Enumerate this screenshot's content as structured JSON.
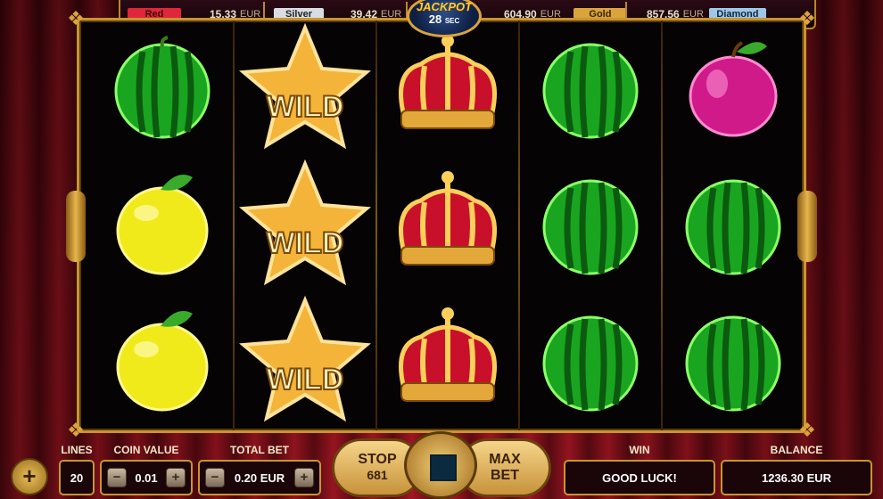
{
  "jackpots": [
    {
      "name": "Red",
      "value": "15.33",
      "currency": "EUR",
      "color": "#e0263a"
    },
    {
      "name": "Silver",
      "value": "39.42",
      "currency": "EUR",
      "color": "#d8dde3"
    },
    {
      "name": "Gold",
      "value": "604.90",
      "currency": "EUR",
      "color": "#d9a43c"
    },
    {
      "name": "Diamond",
      "value": "857.56",
      "currency": "EUR",
      "color": "#9fc8e8"
    }
  ],
  "jackpot_timer": {
    "title": "JACKPOT",
    "seconds": "28",
    "unit": "SEC"
  },
  "reels": [
    [
      "watermelon-icon",
      "lemon-icon",
      "lemon-icon"
    ],
    [
      "wild-star-icon",
      "wild-star-icon",
      "wild-star-icon"
    ],
    [
      "crown-icon",
      "crown-icon",
      "crown-icon"
    ],
    [
      "watermelon-icon",
      "watermelon-icon",
      "watermelon-icon"
    ],
    [
      "plum-icon",
      "watermelon-icon",
      "watermelon-icon"
    ]
  ],
  "wild_text": "WILD",
  "controls": {
    "lines_label": "LINES",
    "lines_value": "20",
    "coin_value_label": "COIN VALUE",
    "coin_value": "0.01",
    "total_bet_label": "TOTAL BET",
    "total_bet_value": "0.20 EUR",
    "stop_label": "STOP",
    "stop_count": "681",
    "max_bet_line1": "MAX",
    "max_bet_line2": "BET",
    "win_label": "WIN",
    "win_value": "GOOD LUCK!",
    "balance_label": "BALANCE",
    "balance_value": "1236.30 EUR",
    "minus_glyph": "−",
    "plus_glyph": "+"
  },
  "colors": {
    "frame_gold": "#c8952f",
    "panel_dark": "#1a0508"
  }
}
